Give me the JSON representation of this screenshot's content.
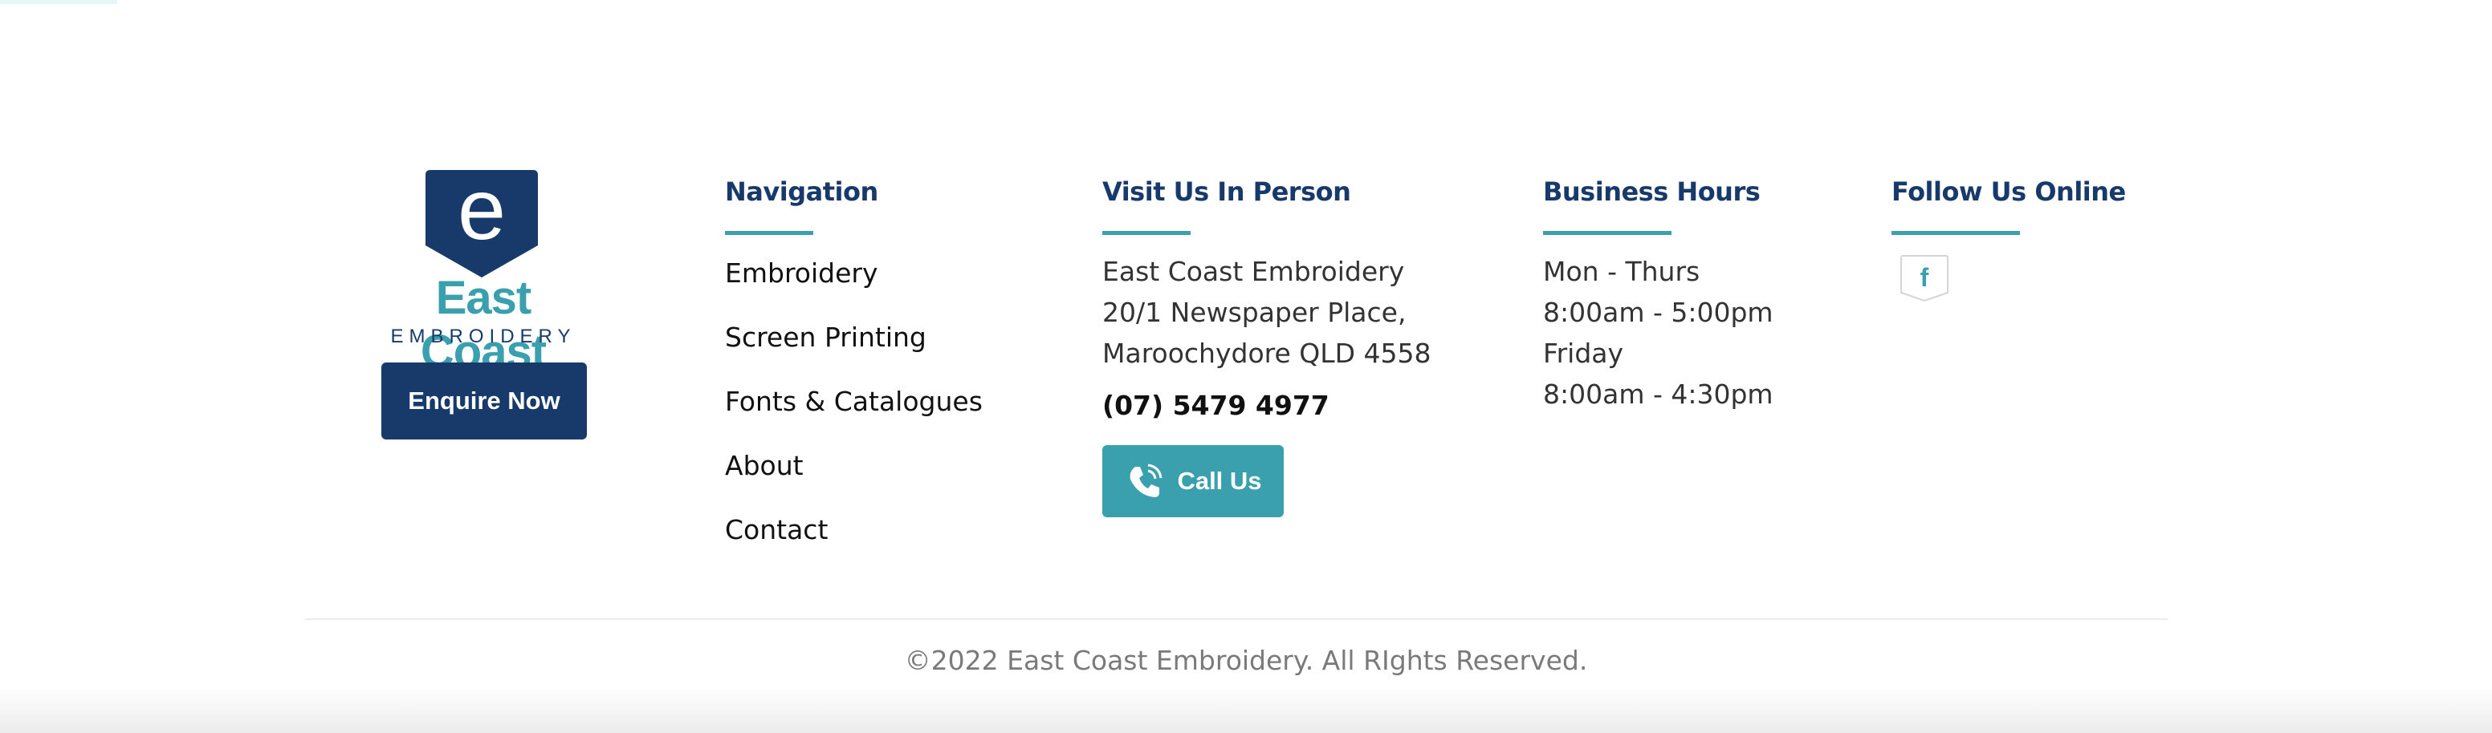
{
  "brand": {
    "logo_letter": "e",
    "name_line1": "East Coast",
    "name_line2": "EMBROIDERY",
    "enquire_label": "Enquire Now"
  },
  "navigation": {
    "heading": "Navigation",
    "items": [
      {
        "label": "Embroidery"
      },
      {
        "label": "Screen Printing"
      },
      {
        "label": "Fonts & Catalogues"
      },
      {
        "label": "About"
      },
      {
        "label": "Contact"
      }
    ]
  },
  "visit": {
    "heading": "Visit Us In Person",
    "address_lines": [
      "East Coast Embroidery",
      "20/1 Newspaper Place,",
      "Maroochydore QLD 4558"
    ],
    "phone": "(07) 5479 4977",
    "call_label": "Call Us"
  },
  "hours": {
    "heading": "Business Hours",
    "lines": [
      "Mon - Thurs",
      "8:00am - 5:00pm",
      "Friday",
      "8:00am - 4:30pm"
    ]
  },
  "follow": {
    "heading": "Follow Us Online",
    "icons": [
      "facebook-icon"
    ]
  },
  "footer": {
    "copyright": "©2022 East Coast Embroidery. All RIghts Reserved."
  },
  "colors": {
    "navy": "#173a6b",
    "teal": "#3aa0ad",
    "text": "#111111",
    "muted": "#7a7a7a"
  }
}
